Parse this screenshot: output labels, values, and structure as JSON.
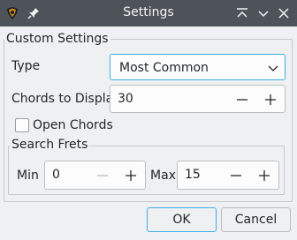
{
  "window": {
    "title": "Settings"
  },
  "group_custom": {
    "title": "Custom Settings"
  },
  "type_row": {
    "label": "Type",
    "value": "Most Common"
  },
  "chords_row": {
    "label": "Chords to Display",
    "value": "30"
  },
  "open_chords": {
    "label": "Open Chords",
    "checked": false
  },
  "group_frets": {
    "title": "Search Frets"
  },
  "min_row": {
    "label": "Min",
    "value": "0"
  },
  "max_row": {
    "label": "Max",
    "value": "15"
  },
  "buttons": {
    "ok": "OK",
    "cancel": "Cancel"
  },
  "colors": {
    "titlebar": "#4d5358",
    "window_bg": "#eff0f1",
    "accent": "#3daee9",
    "text": "#232629"
  },
  "icons": [
    "app-icon",
    "pin-icon",
    "keep-above-icon",
    "minimize-icon",
    "close-icon",
    "chevron-down-icon",
    "minus-icon",
    "plus-icon"
  ]
}
